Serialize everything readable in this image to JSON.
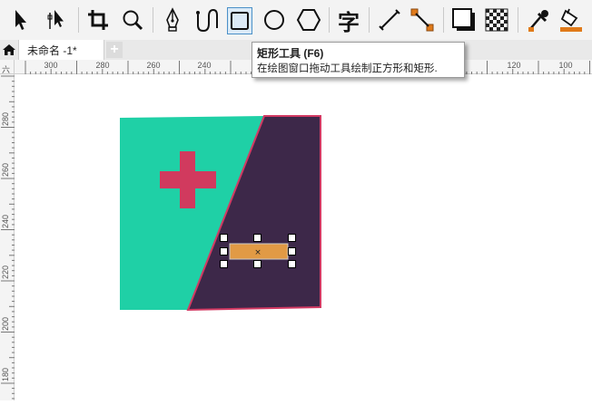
{
  "toolbar": {
    "tools": [
      {
        "name": "pick-tool",
        "icon": "arrow-pointer-icon"
      },
      {
        "name": "shape-tool",
        "icon": "node-edit-icon"
      },
      {
        "name": "crop-tool",
        "icon": "crop-icon"
      },
      {
        "name": "zoom-tool",
        "icon": "magnifier-icon"
      },
      {
        "name": "freehand-tool",
        "icon": "pen-nib-icon"
      },
      {
        "name": "artistic-media-tool",
        "icon": "curve-icon"
      },
      {
        "name": "rectangle-tool",
        "icon": "rectangle-icon",
        "active": true
      },
      {
        "name": "ellipse-tool",
        "icon": "ellipse-icon"
      },
      {
        "name": "polygon-tool",
        "icon": "hexagon-icon"
      },
      {
        "name": "text-tool",
        "icon": "text-char-icon",
        "glyph": "字"
      },
      {
        "name": "parallel-dimension-tool",
        "icon": "dimension-line-icon"
      },
      {
        "name": "connector-tool",
        "icon": "connector-icon"
      },
      {
        "name": "drop-shadow-tool",
        "icon": "drop-shadow-icon"
      },
      {
        "name": "transparency-tool",
        "icon": "checkerboard-icon"
      },
      {
        "name": "color-eyedropper-tool",
        "icon": "eyedropper-icon"
      },
      {
        "name": "interactive-fill-tool",
        "icon": "paint-bucket-icon"
      }
    ]
  },
  "tabs": {
    "items": [
      {
        "label": "未命名 -1*"
      }
    ],
    "add_label": "+"
  },
  "rulers": {
    "horizontal": [
      "300",
      "280",
      "260",
      "240",
      "120",
      "100"
    ],
    "vertical": [
      "280",
      "260",
      "240",
      "220",
      "200",
      "180"
    ],
    "corner_glyph": "六"
  },
  "tooltip": {
    "title": "矩形工具 (F6)",
    "description": "在绘图窗口拖动工具绘制正方形和矩形."
  },
  "drawing": {
    "colors": {
      "teal": "#1fd0a6",
      "dark_purple": "#3d2849",
      "outline": "#d23a63",
      "cross": "#d13a5e",
      "small_rect": "#e19a45"
    },
    "selected_object": "small-rectangle",
    "selection_handles": 8
  }
}
